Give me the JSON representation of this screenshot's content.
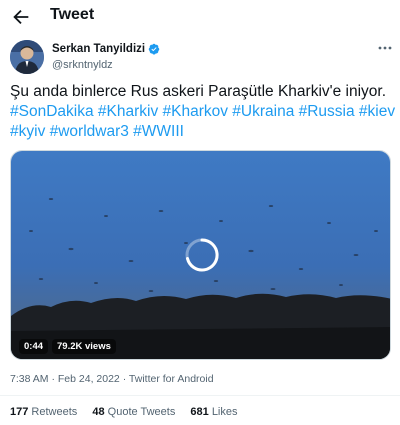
{
  "header": {
    "title": "Tweet",
    "back_icon": "arrow-left-icon"
  },
  "author": {
    "display_name": "Serkan Tanyildizi",
    "handle": "@srkntnyldz",
    "verified_icon": "verified-badge-icon",
    "more_icon": "more-horizontal-icon"
  },
  "tweet": {
    "text": "Şu anda binlerce Rus askeri Paraşütle Kharkiv'e iniyor.",
    "hashtag_line_1": "#SonDakika #Kharkiv #Kharkov #Ukraina #Russia #kiev",
    "hashtag_line_2": "#kyiv #worldwar3 #WWIII"
  },
  "video": {
    "duration": "0:44",
    "views": "79.2K views",
    "loading_icon": "loading-spinner-icon"
  },
  "meta": {
    "time": "7:38 AM",
    "date": "Feb 24, 2022",
    "source": "Twitter for Android",
    "separator": "·"
  },
  "stats": {
    "retweets_count": "177",
    "retweets_label": "Retweets",
    "quote_count": "48",
    "quote_label": "Quote Tweets",
    "likes_count": "681",
    "likes_label": "Likes"
  },
  "colors": {
    "accent": "#1d9bf0",
    "text": "#0f1419",
    "muted": "#536471"
  }
}
